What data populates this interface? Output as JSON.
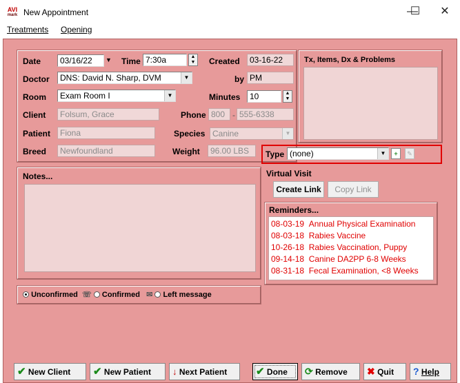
{
  "window": {
    "logo_text": "AVI",
    "logo_sub": "mark",
    "title": "New Appointment",
    "min": "—",
    "max": "☐",
    "close": "✕"
  },
  "menu": {
    "treatments": "Treatments",
    "opening": "Opening"
  },
  "form": {
    "date_label": "Date",
    "date_value": "03/16/22",
    "time_label": "Time",
    "time_value": "7:30a",
    "created_label": "Created",
    "created_value": "03-16-22",
    "doctor_label": "Doctor",
    "doctor_value": "DNS: David N. Sharp, DVM",
    "by_label": "by",
    "by_value": "PM",
    "room_label": "Room",
    "room_value": "Exam Room I",
    "minutes_label": "Minutes",
    "minutes_value": "10",
    "client_label": "Client",
    "client_value": "Folsum, Grace",
    "phone_label": "Phone",
    "phone_area": "800",
    "phone_number": "555-6338",
    "patient_label": "Patient",
    "patient_value": "Fiona",
    "species_label": "Species",
    "species_value": "Canine",
    "breed_label": "Breed",
    "breed_value": "Newfoundland",
    "weight_label": "Weight",
    "weight_value": "96.00 LBS"
  },
  "tx_panel": {
    "title": "Tx, Items, Dx & Problems"
  },
  "type": {
    "label": "Type",
    "value": "(none)"
  },
  "notes": {
    "title": "Notes..."
  },
  "virtual": {
    "title": "Virtual Visit",
    "create_link": "Create Link",
    "copy_link": "Copy Link"
  },
  "reminders": {
    "title": "Reminders...",
    "items": [
      {
        "date": "08-03-19",
        "text": "Annual Physical Examination"
      },
      {
        "date": "08-03-18",
        "text": "Rabies Vaccine"
      },
      {
        "date": "10-26-18",
        "text": "Rabies Vaccination, Puppy"
      },
      {
        "date": "09-14-18",
        "text": "Canine DA2PP 6-8 Weeks"
      },
      {
        "date": "08-31-18",
        "text": "Fecal Examination, <8 Weeks"
      }
    ]
  },
  "confirmation": {
    "unconfirmed": "Unconfirmed",
    "confirmed": "Confirmed",
    "left_message": "Left message",
    "selected": "unconfirmed"
  },
  "buttons": {
    "new_client": "New Client",
    "new_patient": "New Patient",
    "next_patient": "Next Patient",
    "done": "Done",
    "remove": "Remove",
    "quit": "Quit",
    "help": "Help"
  },
  "colors": {
    "panel_bg": "#e79a9a",
    "reminder_text": "#e00000",
    "type_highlight": "#e00000"
  }
}
